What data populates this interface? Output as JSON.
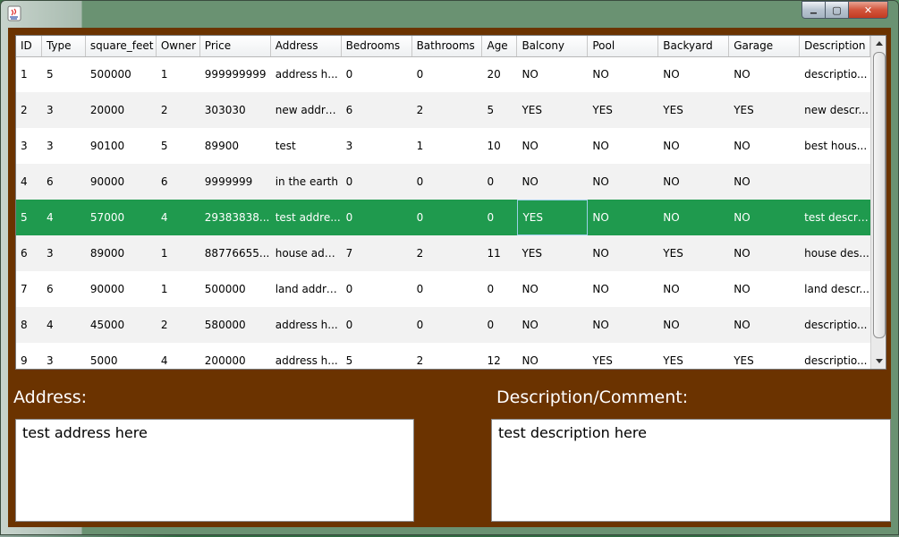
{
  "window": {
    "minimize_label": "▁",
    "maximize_label": "▢",
    "close_label": "✕"
  },
  "table": {
    "columns": [
      "ID",
      "Type",
      "square_feet",
      "Owner",
      "Price",
      "Address",
      "Bedrooms",
      "Bathrooms",
      "Age",
      "Balcony",
      "Pool",
      "Backyard",
      "Garage",
      "Description"
    ],
    "rows": [
      [
        "1",
        "5",
        "500000",
        "1",
        "999999999",
        "address h...",
        "0",
        "0",
        "20",
        "NO",
        "NO",
        "NO",
        "NO",
        "descriptio..."
      ],
      [
        "2",
        "3",
        "20000",
        "2",
        "303030",
        "new addre...",
        "6",
        "2",
        "5",
        "YES",
        "YES",
        "YES",
        "YES",
        "new descr..."
      ],
      [
        "3",
        "3",
        "90100",
        "5",
        "89900",
        "test",
        "3",
        "1",
        "10",
        "NO",
        "NO",
        "NO",
        "NO",
        "best hous..."
      ],
      [
        "4",
        "6",
        "90000",
        "6",
        "9999999",
        "in the earth",
        "0",
        "0",
        "0",
        "NO",
        "NO",
        "NO",
        "NO",
        ""
      ],
      [
        "5",
        "4",
        "57000",
        "4",
        "29383838...",
        "test addre...",
        "0",
        "0",
        "0",
        "YES",
        "NO",
        "NO",
        "NO",
        "test descri..."
      ],
      [
        "6",
        "3",
        "89000",
        "1",
        "88776655...",
        "house add...",
        "7",
        "2",
        "11",
        "YES",
        "NO",
        "YES",
        "NO",
        "house des..."
      ],
      [
        "7",
        "6",
        "90000",
        "1",
        "500000",
        "land addre...",
        "0",
        "0",
        "0",
        "NO",
        "NO",
        "NO",
        "NO",
        "land descr..."
      ],
      [
        "8",
        "4",
        "45000",
        "2",
        "580000",
        "address h...",
        "0",
        "0",
        "0",
        "NO",
        "NO",
        "NO",
        "NO",
        "descriptio..."
      ],
      [
        "9",
        "3",
        "5000",
        "4",
        "200000",
        "address h...",
        "5",
        "2",
        "12",
        "NO",
        "YES",
        "YES",
        "YES",
        "descriptio..."
      ]
    ],
    "selected_row_index": 4,
    "focused_column_index": 9,
    "selection_color": "#1f9a4e"
  },
  "address": {
    "label": "Address:",
    "value": "test address here"
  },
  "description": {
    "label": "Description/Comment:",
    "value": "test description here"
  },
  "colors": {
    "panel_background": "#6b3300"
  }
}
